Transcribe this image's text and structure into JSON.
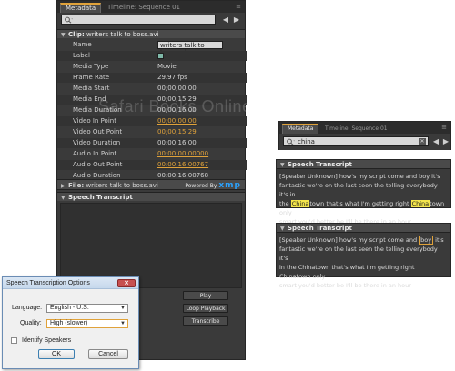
{
  "watermark": "Safari Books Online #3177291/3121",
  "main_panel": {
    "tabs": [
      {
        "label": "Metadata"
      },
      {
        "label": "Timeline: Sequence 01"
      }
    ],
    "clip_section": {
      "prefix": "Clip:",
      "name": "writers talk to boss.avi"
    },
    "rows": [
      {
        "label": "Name",
        "value": "writers talk to boss.avi",
        "kind": "field"
      },
      {
        "label": "Label",
        "value": "",
        "kind": "swatch",
        "color": "#7fb8a8"
      },
      {
        "label": "Media Type",
        "value": "Movie",
        "kind": "text"
      },
      {
        "label": "Frame Rate",
        "value": "29.97 fps",
        "kind": "text"
      },
      {
        "label": "Media Start",
        "value": "00;00;00;00",
        "kind": "text"
      },
      {
        "label": "Media End",
        "value": "00;00;15;29",
        "kind": "text"
      },
      {
        "label": "Media Duration",
        "value": "00;00;16;00",
        "kind": "text"
      },
      {
        "label": "Video In Point",
        "value": "00;00;00;00",
        "kind": "link"
      },
      {
        "label": "Video Out Point",
        "value": "00;00;15;29",
        "kind": "link"
      },
      {
        "label": "Video Duration",
        "value": "00;00;16;00",
        "kind": "text"
      },
      {
        "label": "Audio In Point",
        "value": "00:00:00:00000",
        "kind": "link"
      },
      {
        "label": "Audio Out Point",
        "value": "00:00:16:00767",
        "kind": "link"
      },
      {
        "label": "Audio Duration",
        "value": "00:00:16:00768",
        "kind": "text"
      }
    ],
    "file_section": {
      "prefix": "File:",
      "name": "writers talk to boss.avi",
      "powered_by": "Powered By",
      "brand": "xmp"
    },
    "speech_section": {
      "title": "Speech Transcript"
    },
    "buttons": {
      "play": "Play",
      "loop": "Loop Playback",
      "transcribe": "Transcribe"
    }
  },
  "right_panel": {
    "tabs": [
      {
        "label": "Metadata"
      },
      {
        "label": "Timeline: Sequence 01"
      }
    ],
    "search_value": "china"
  },
  "transcript_card_1": {
    "title": "Speech Transcript",
    "line1": "[Speaker Unknown] how's my  script come and boy it's",
    "line2": "fantastic we're on the last seen the telling  everybody  it's in",
    "line3_pre": "the ",
    "line3_hl1": "China",
    "line3_mid": "town that's what I'm  getting right ",
    "line3_hl2": "China",
    "line3_post": "town only",
    "line4": "smart you'd better be I'll be there in an  hour"
  },
  "transcript_card_2": {
    "title": "Speech Transcript",
    "line1_pre": "[Speaker Unknown] how's my  script come and ",
    "line1_box": "boy",
    "line1_post": " it's",
    "line2": "fantastic we're on the last seen the telling  everybody  it's",
    "line3": "in the Chinatown that's what I'm  getting right Chinatown only",
    "line4": "smart you'd better be I'll be there in an  hour"
  },
  "dialog": {
    "title": "Speech Transcription Options",
    "language_label": "Language:",
    "language_value": "English - U.S.",
    "quality_label": "Quality:",
    "quality_value": "High (slower)",
    "identify_speakers": "Identify Speakers",
    "ok": "OK",
    "cancel": "Cancel"
  }
}
